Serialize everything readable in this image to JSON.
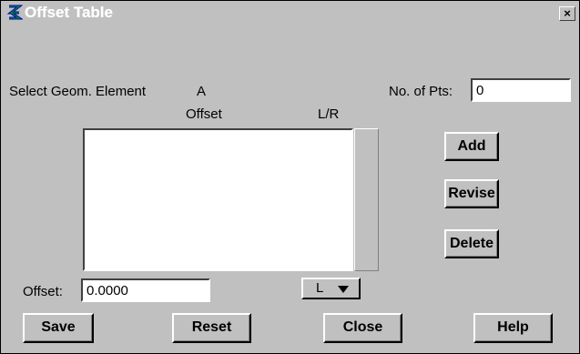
{
  "window": {
    "title": "Offset Table",
    "close_glyph": "×"
  },
  "labels": {
    "select_geom": "Select Geom. Element",
    "geom_value": "A",
    "no_of_pts": "No. of Pts:",
    "col_offset": "Offset",
    "col_lr": "L/R",
    "offset": "Offset:"
  },
  "fields": {
    "no_of_pts_value": "0",
    "offset_value": "0.0000",
    "lr_value": "L"
  },
  "list": {
    "rows": []
  },
  "buttons": {
    "add": "Add",
    "revise": "Revise",
    "delete": "Delete",
    "save": "Save",
    "reset": "Reset",
    "close": "Close",
    "help": "Help"
  },
  "icons": {
    "app": "app-logo-icon",
    "close": "close-icon",
    "dropdown": "triangle-down-icon"
  }
}
